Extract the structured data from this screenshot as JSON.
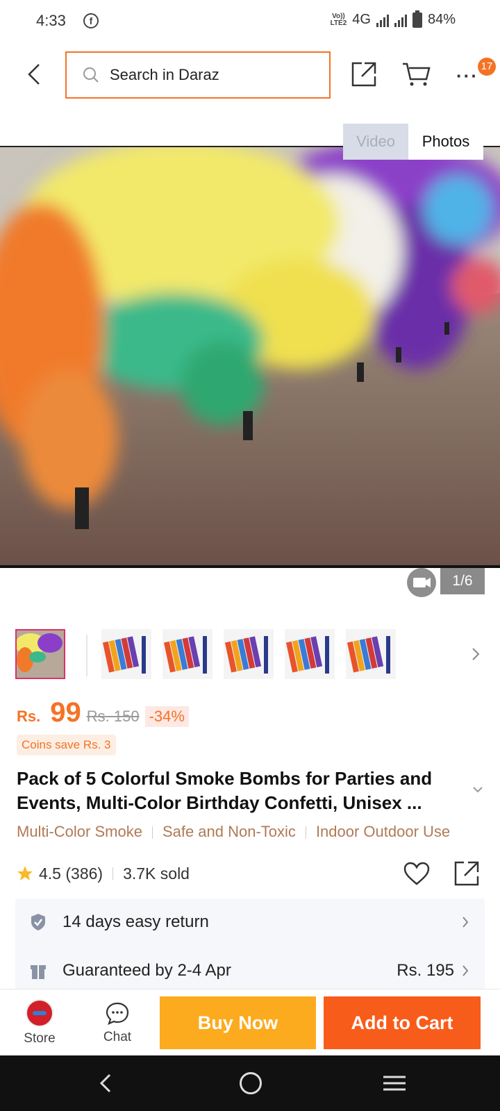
{
  "status_bar": {
    "time": "4:33",
    "network": "4G",
    "volte_top": "Vo))",
    "volte_bottom": "LTE2",
    "battery": "84%"
  },
  "header": {
    "search_placeholder": "Search in Daraz",
    "cart_badge": "17"
  },
  "media": {
    "tab_video": "Video",
    "tab_photos": "Photos",
    "counter": "1/6"
  },
  "product": {
    "currency": "Rs.",
    "price": "99",
    "old_price": "Rs. 150",
    "discount": "-34%",
    "coins": "Coins save Rs. 3",
    "title": "Pack of 5 Colorful Smoke Bombs for Parties and Events, Multi-Color Birthday Confetti, Unisex ...",
    "tags": [
      "Multi-Color Smoke",
      "Safe and Non-Toxic",
      "Indoor Outdoor Use"
    ],
    "rating": "4.5",
    "reviews": "(386)",
    "sold": "3.7K sold"
  },
  "services": {
    "return": "14 days easy return",
    "delivery": "Guaranteed by 2-4 Apr",
    "delivery_fee": "Rs. 195"
  },
  "actions": {
    "store": "Store",
    "chat": "Chat",
    "buy_now": "Buy Now",
    "add_to_cart": "Add to Cart"
  },
  "colors": {
    "accent": "#f57224",
    "buy_now": "#fcab1e",
    "add_to_cart": "#f85c1a",
    "tag_text": "#b07a56"
  },
  "icons": [
    "facebook-icon",
    "search-icon",
    "back-icon",
    "share-icon",
    "cart-icon",
    "more-icon",
    "video-icon",
    "star-icon",
    "heart-icon",
    "shield-icon",
    "gift-icon",
    "chat-icon",
    "chevron-right-icon"
  ]
}
